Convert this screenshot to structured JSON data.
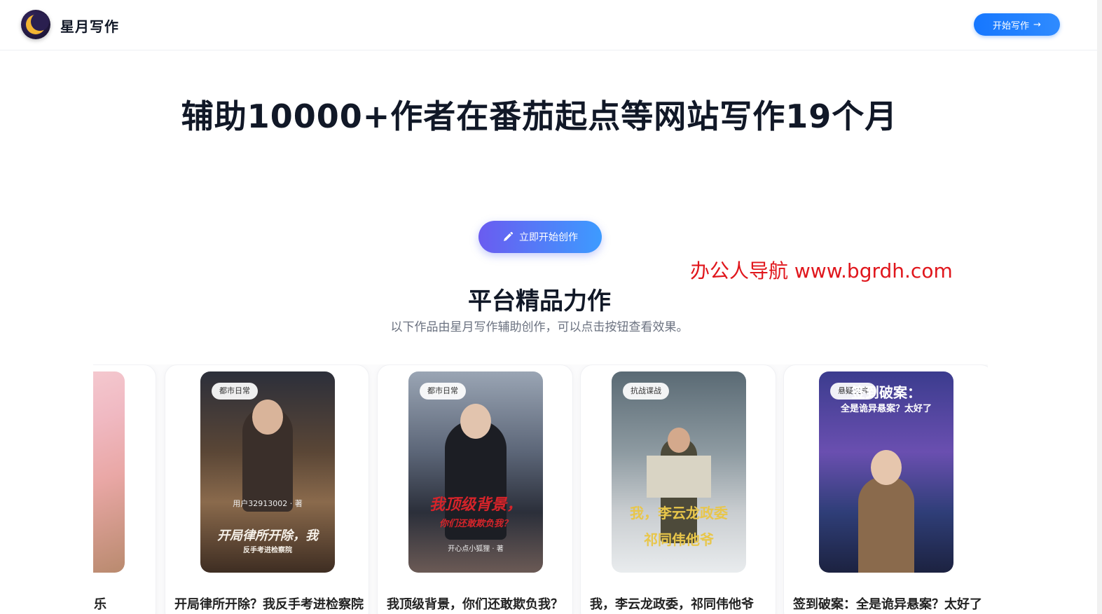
{
  "nav": {
    "brand": "星月写作",
    "start_button": "开始写作",
    "start_button_icon": "arrow-right-icon"
  },
  "hero": {
    "title": "辅助10000+作者在番茄起点等网站写作19个月",
    "cta_label": "立即开始创作",
    "cta_icon": "pencil-icon"
  },
  "watermark": "办公人导航 www.bgrdh.com",
  "section": {
    "title": "平台精品力作",
    "subtitle": "以下作品由星月写作辅助创作，可以点击按钮查看效果。"
  },
  "cards": [
    {
      "title": "乐",
      "tag": ""
    },
    {
      "title": "开局律所开除？我反手考进检察院",
      "tag": "都市日常",
      "cover_text": "开局律所开除，我",
      "cover_sub": "反手考进检察院",
      "cover_author": "用户32913002 · 著"
    },
    {
      "title": "我顶级背景，你们还敢欺负我？",
      "tag": "都市日常",
      "cover_text": "我顶级背景，",
      "cover_sub": "你们还敢欺负我？",
      "cover_author": "开心点小狐狸 · 著"
    },
    {
      "title": "我，李云龙政委，祁同伟他爷",
      "tag": "抗战谍战",
      "cover_text": "我，李云龙政委",
      "cover_sub": "祁同伟他爷"
    },
    {
      "title": "签到破案：全是诡异悬案？太好了",
      "tag": "悬疑灵异",
      "cover_text": "签到破案：",
      "cover_sub": "全是诡异悬案？太好了"
    }
  ],
  "colors": {
    "primary": "#1677ff",
    "gradient_start": "#6a5cf0",
    "gradient_end": "#3d9bff",
    "watermark": "#e0161c"
  }
}
